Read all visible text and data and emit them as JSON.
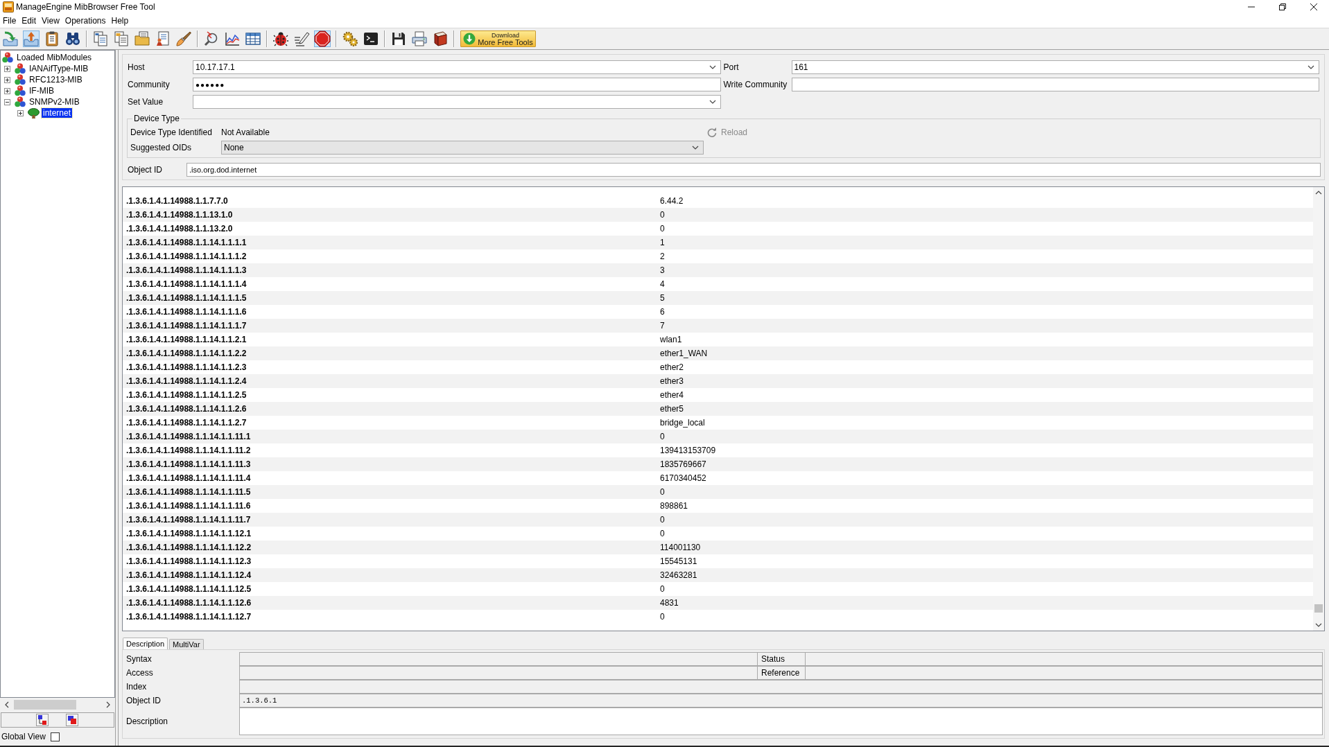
{
  "window": {
    "title": "ManageEngine MibBrowser Free Tool"
  },
  "menu": [
    "File",
    "Edit",
    "View",
    "Operations",
    "Help"
  ],
  "toolbar": {
    "groups": [
      [
        {
          "pressed": false
        },
        {
          "pressed": true
        },
        {
          "pressed": false
        },
        {
          "pressed": false
        }
      ],
      [
        {
          "pressed": false
        },
        {
          "pressed": false
        },
        {
          "pressed": false
        },
        {
          "pressed": false
        },
        {
          "pressed": false
        }
      ],
      [
        {
          "pressed": false
        },
        {
          "pressed": false
        },
        {
          "pressed": false
        }
      ],
      [
        {
          "pressed": false
        },
        {
          "pressed": false
        },
        {
          "pressed": true
        }
      ],
      [
        {
          "pressed": false
        },
        {
          "pressed": false
        }
      ],
      [
        {
          "pressed": false
        },
        {
          "pressed": false
        },
        {
          "pressed": false
        }
      ]
    ],
    "download_button": {
      "line_1": "Download",
      "line_2": "More Free Tools"
    }
  },
  "tree": {
    "label": "Loaded MibModules",
    "selected": false,
    "children": [
      {
        "label": "IANAifType-MIB",
        "expanded": false,
        "selected": false
      },
      {
        "label": "RFC1213-MIB",
        "expanded": false,
        "selected": false
      },
      {
        "label": "IF-MIB",
        "expanded": false,
        "selected": false
      },
      {
        "label": "SNMPv2-MIB",
        "expanded": true,
        "selected": false,
        "children": [
          {
            "label": "internet",
            "expanded": false,
            "selected": true
          }
        ]
      }
    ]
  },
  "global_view": {
    "label": "Global View",
    "checked": false
  },
  "form": {
    "host": {
      "label": "Host",
      "value": "10.17.17.1"
    },
    "port": {
      "label": "Port",
      "value": "161"
    },
    "community": {
      "label": "Community",
      "value": "●●●●●●"
    },
    "write_community": {
      "label": "Write Community"
    },
    "set_value": {
      "label": "Set Value"
    }
  },
  "device_type": {
    "title": "Device Type",
    "identified_label": "Device Type Identified",
    "identified_value": "Not Available",
    "reload_button": {
      "label": "Reload",
      "disabled": true
    },
    "suggested_oids": {
      "label": "Suggested OIDs",
      "value": "None"
    }
  },
  "object_id": {
    "label": "Object ID",
    "value": ".iso.org.dod.internet"
  },
  "results": {
    "rows": [
      [
        ".1.3.6.1.4.1.14988.1.1.7.7.0",
        "6.44.2"
      ],
      [
        ".1.3.6.1.4.1.14988.1.1.13.1.0",
        "0"
      ],
      [
        ".1.3.6.1.4.1.14988.1.1.13.2.0",
        "0"
      ],
      [
        ".1.3.6.1.4.1.14988.1.1.14.1.1.1.1",
        "1"
      ],
      [
        ".1.3.6.1.4.1.14988.1.1.14.1.1.1.2",
        "2"
      ],
      [
        ".1.3.6.1.4.1.14988.1.1.14.1.1.1.3",
        "3"
      ],
      [
        ".1.3.6.1.4.1.14988.1.1.14.1.1.1.4",
        "4"
      ],
      [
        ".1.3.6.1.4.1.14988.1.1.14.1.1.1.5",
        "5"
      ],
      [
        ".1.3.6.1.4.1.14988.1.1.14.1.1.1.6",
        "6"
      ],
      [
        ".1.3.6.1.4.1.14988.1.1.14.1.1.1.7",
        "7"
      ],
      [
        ".1.3.6.1.4.1.14988.1.1.14.1.1.2.1",
        "wlan1"
      ],
      [
        ".1.3.6.1.4.1.14988.1.1.14.1.1.2.2",
        "ether1_WAN"
      ],
      [
        ".1.3.6.1.4.1.14988.1.1.14.1.1.2.3",
        "ether2"
      ],
      [
        ".1.3.6.1.4.1.14988.1.1.14.1.1.2.4",
        "ether3"
      ],
      [
        ".1.3.6.1.4.1.14988.1.1.14.1.1.2.5",
        "ether4"
      ],
      [
        ".1.3.6.1.4.1.14988.1.1.14.1.1.2.6",
        "ether5"
      ],
      [
        ".1.3.6.1.4.1.14988.1.1.14.1.1.2.7",
        "bridge_local"
      ],
      [
        ".1.3.6.1.4.1.14988.1.1.14.1.1.11.1",
        "0"
      ],
      [
        ".1.3.6.1.4.1.14988.1.1.14.1.1.11.2",
        "139413153709"
      ],
      [
        ".1.3.6.1.4.1.14988.1.1.14.1.1.11.3",
        "1835769667"
      ],
      [
        ".1.3.6.1.4.1.14988.1.1.14.1.1.11.4",
        "6170340452"
      ],
      [
        ".1.3.6.1.4.1.14988.1.1.14.1.1.11.5",
        "0"
      ],
      [
        ".1.3.6.1.4.1.14988.1.1.14.1.1.11.6",
        "898861"
      ],
      [
        ".1.3.6.1.4.1.14988.1.1.14.1.1.11.7",
        "0"
      ],
      [
        ".1.3.6.1.4.1.14988.1.1.14.1.1.12.1",
        "0"
      ],
      [
        ".1.3.6.1.4.1.14988.1.1.14.1.1.12.2",
        "114001130"
      ],
      [
        ".1.3.6.1.4.1.14988.1.1.14.1.1.12.3",
        "15545131"
      ],
      [
        ".1.3.6.1.4.1.14988.1.1.14.1.1.12.4",
        "32463281"
      ],
      [
        ".1.3.6.1.4.1.14988.1.1.14.1.1.12.5",
        "0"
      ],
      [
        ".1.3.6.1.4.1.14988.1.1.14.1.1.12.6",
        "4831"
      ],
      [
        ".1.3.6.1.4.1.14988.1.1.14.1.1.12.7",
        "0"
      ]
    ]
  },
  "detail_tabs": [
    {
      "label": "Description",
      "selected": true
    },
    {
      "label": "MultiVar",
      "selected": false
    }
  ],
  "details": {
    "rows": [
      [
        {
          "label": "Syntax",
          "kind": "text"
        },
        {
          "label": "Status",
          "kind": "text"
        }
      ],
      [
        {
          "label": "Access",
          "kind": "text"
        },
        {
          "label": "Reference",
          "kind": "text"
        }
      ],
      [
        {
          "label": "Index",
          "kind": "text"
        }
      ],
      [
        {
          "label": "Object ID",
          "kind": "text",
          "value": ".1.3.6.1"
        }
      ],
      [
        {
          "label": "Description",
          "kind": "textarea"
        }
      ]
    ]
  }
}
